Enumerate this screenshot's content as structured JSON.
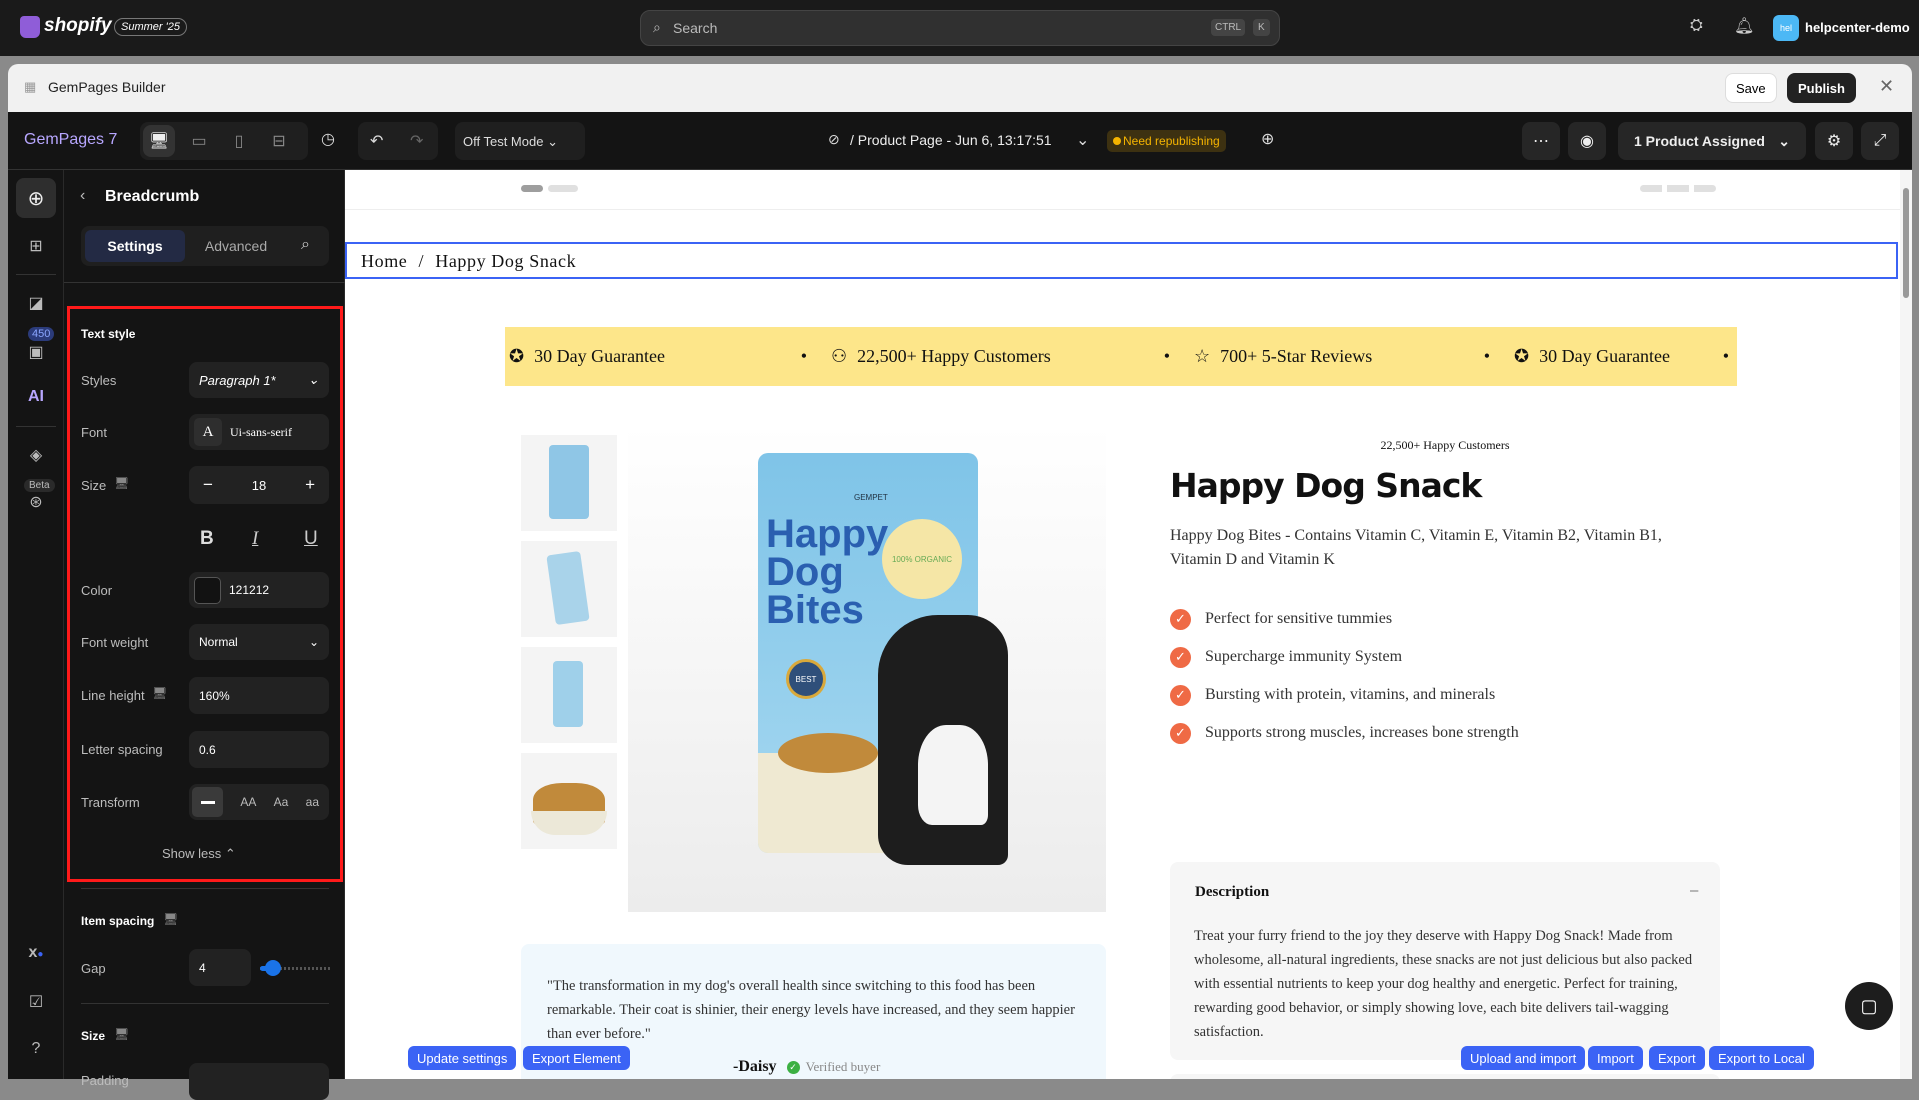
{
  "shopify": {
    "logo": "shopify",
    "edition": "Summer '25",
    "search_placeholder": "Search",
    "kbd1": "CTRL",
    "kbd2": "K",
    "avatar": "hel",
    "store": "helpcenter-demo"
  },
  "app": {
    "title": "GemPages Builder",
    "save": "Save",
    "publish": "Publish"
  },
  "toolbar": {
    "brand": "GemPages 7",
    "test_mode": "Off Test Mode",
    "page": "/ Product Page - Jun 6, 13:17:51",
    "status": "Need republishing",
    "assigned": "1 Product Assigned"
  },
  "rail": {
    "badge": "450",
    "ai": "AI",
    "beta": "Beta"
  },
  "panel": {
    "title": "Breadcrumb",
    "tabs": [
      "Settings",
      "Advanced"
    ],
    "text_style": "Text style",
    "styles_label": "Styles",
    "styles_value": "Paragraph 1*",
    "font_label": "Font",
    "font_value": "Ui-sans-serif",
    "font_glyph": "A",
    "size_label": "Size",
    "size_value": "18",
    "minus": "−",
    "plus": "+",
    "bold": "B",
    "italic": "I",
    "underline": "U",
    "color_label": "Color",
    "color_value": "121212",
    "weight_label": "Font weight",
    "weight_value": "Normal",
    "lh_label": "Line height",
    "lh_value": "160%",
    "ls_label": "Letter spacing",
    "ls_value": "0.6",
    "transform_label": "Transform",
    "transform_options": [
      "AA",
      "Aa",
      "aa"
    ],
    "show_less": "Show less",
    "item_spacing": "Item spacing",
    "gap_label": "Gap",
    "gap_value": "4",
    "gap_slider_fraction": 0.1,
    "size_section": "Size",
    "padding_label": "Padding"
  },
  "page": {
    "breadcrumb": [
      "Home",
      "Happy Dog Snack"
    ],
    "separator": "/",
    "marquee": [
      "30 Day Guarantee",
      "22,500+ Happy Customers",
      "700+ 5-Star Reviews",
      "30 Day Guarantee"
    ],
    "bullet": "•",
    "customers": "22,500+ Happy Customers",
    "title": "Happy Dog Snack",
    "subtitle": "Happy Dog Bites - Contains Vitamin C, Vitamin E, Vitamin B2, Vitamin B1, Vitamin D and Vitamin K",
    "features": [
      "Perfect for sensitive tummies",
      "Supercharge immunity System",
      "Bursting with protein, vitamins, and minerals",
      "Supports strong muscles, increases bone strength"
    ],
    "bag_text": [
      "Happy",
      "Dog",
      "Bites"
    ],
    "bag_brand": "GEMPET",
    "bag_badge": "100% ORGANIC",
    "bag_seal": "BEST",
    "desc_title": "Description",
    "desc_toggle": "–",
    "desc_body": "Treat your furry friend to the joy they deserve with Happy Dog Snack! Made from wholesome, all-natural ingredients, these snacks are not just delicious but also packed with essential nutrients to keep your dog healthy and energetic. Perfect for training, rewarding good behavior, or simply showing love, each bite delivers tail-wagging satisfaction.",
    "quote": "\"The transformation in my dog's overall health since switching to this food has been remarkable. Their coat is shinier, their energy levels have increased, and they seem happier than ever before.\"",
    "author": "-Daisy",
    "verified": "Verified buyer"
  },
  "actions": {
    "update": "Update settings",
    "export_el": "Export Element",
    "upload": "Upload and import",
    "import": "Import",
    "export": "Export",
    "export_local": "Export to Local"
  },
  "colors": {
    "accent": "#3b63f5",
    "check": "#ef6a45",
    "marquee": "#fde68a",
    "warning": "#f5b400"
  }
}
